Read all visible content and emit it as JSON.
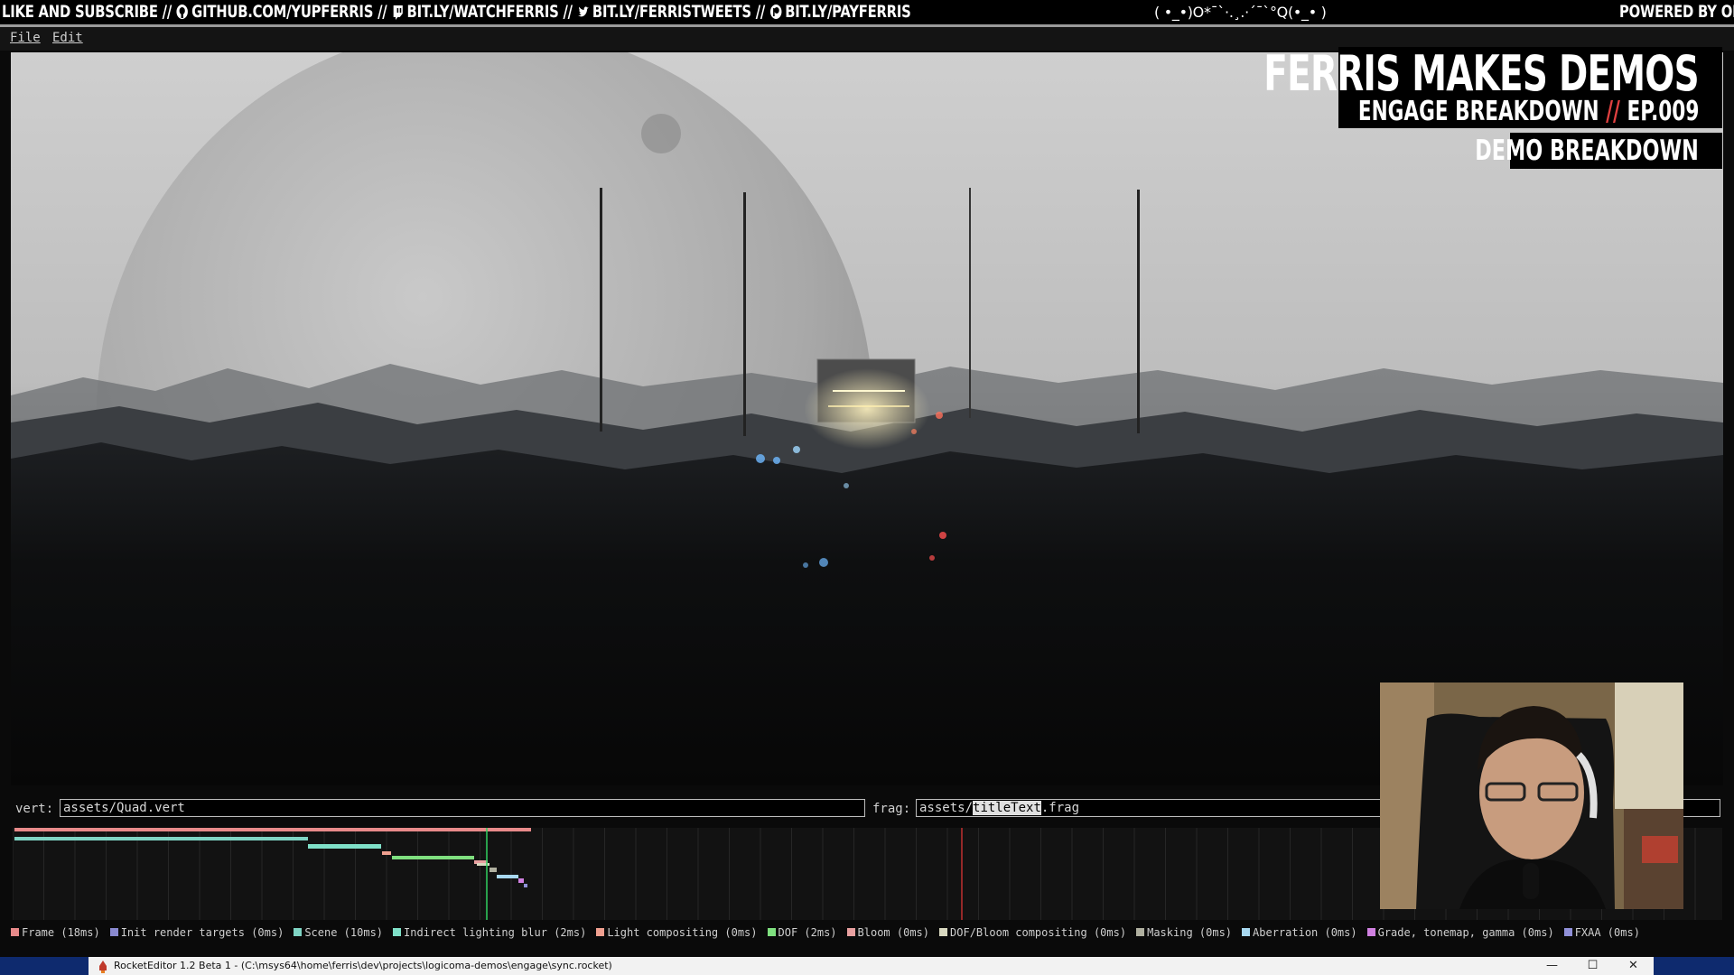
{
  "ticker": {
    "like_subscribe": "LIKE AND SUBSCRIBE",
    "github": "GITHUB.COM/YUPFERRIS",
    "twitch": "BIT.LY/WATCHFERRIS",
    "twitter": "BIT.LY/FERRISTWEETS",
    "patreon": "BIT.LY/PAYFERRIS",
    "separator": "//",
    "kaomoji": "( •_•)O*¯`·.¸.·´¯`°Q(•_• )",
    "powered_by": "POWERED BY OBS"
  },
  "menu": {
    "file": "File",
    "edit": "Edit"
  },
  "overlay": {
    "title": "FERRIS MAKES DEMOS",
    "subtitle_a": "ENGAGE BREAKDOWN",
    "subtitle_sep": "//",
    "subtitle_b": "EP.009",
    "badge": "DEMO BREAKDOWN"
  },
  "shader": {
    "vert_label": "vert:",
    "vert_value": "assets/Quad.vert",
    "frag_label": "frag:",
    "frag_prefix": "assets/",
    "frag_selected": "titleText",
    "frag_suffix": ".frag"
  },
  "profiler": {
    "legend": [
      {
        "label": "Frame (18ms)",
        "color": "#e88a8a"
      },
      {
        "label": "Init render targets (0ms)",
        "color": "#8a8ad0"
      },
      {
        "label": "Scene (10ms)",
        "color": "#7fd4c4"
      },
      {
        "label": "Indirect lighting blur (2ms)",
        "color": "#7fe0c8"
      },
      {
        "label": "Light compositing (0ms)",
        "color": "#f0a090"
      },
      {
        "label": "DOF (2ms)",
        "color": "#7fe07f"
      },
      {
        "label": "Bloom (0ms)",
        "color": "#e8a0a0"
      },
      {
        "label": "DOF/Bloom compositing (0ms)",
        "color": "#d8d8c0"
      },
      {
        "label": "Masking (0ms)",
        "color": "#b0b0a0"
      },
      {
        "label": "Aberration (0ms)",
        "color": "#a8d8f0"
      },
      {
        "label": "Grade, tonemap, gamma (0ms)",
        "color": "#d080e0"
      },
      {
        "label": "FXAA (0ms)",
        "color": "#9090d8"
      }
    ]
  },
  "taskbar": {
    "window_title": "RocketEditor 1.2 Beta 1 - (C:\\msys64\\home\\ferris\\dev\\projects\\logicoma-demos\\engage\\sync.rocket)",
    "minimize": "—",
    "maximize": "☐",
    "close": "✕"
  }
}
